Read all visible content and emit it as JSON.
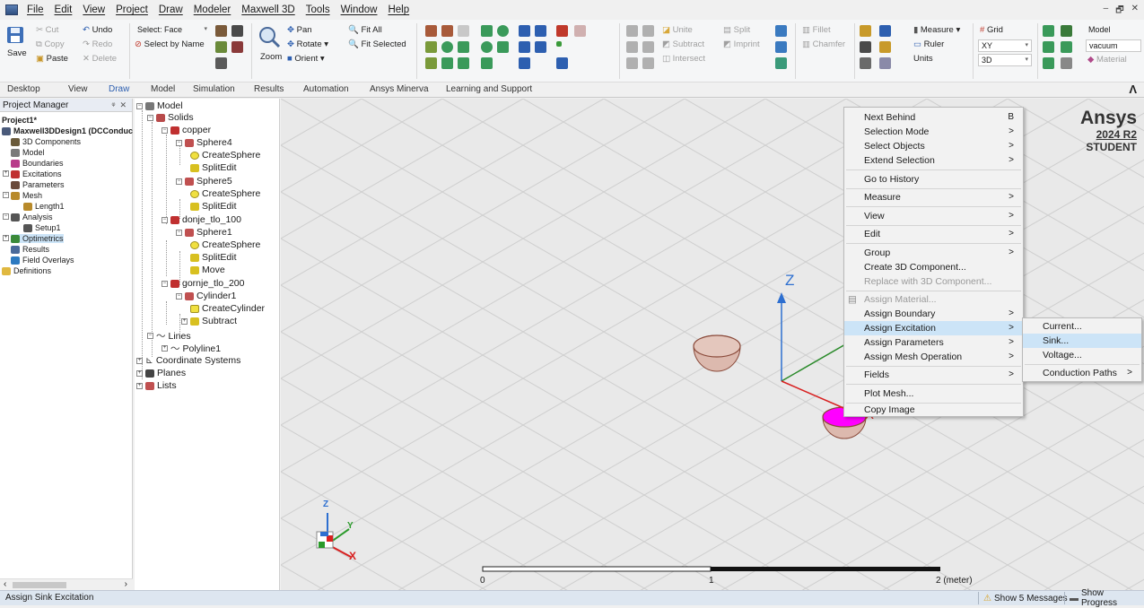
{
  "menubar": {
    "items": [
      "File",
      "Edit",
      "View",
      "Project",
      "Draw",
      "Modeler",
      "Maxwell 3D",
      "Tools",
      "Window",
      "Help"
    ],
    "window_controls": [
      "–",
      "🗗",
      "✕"
    ]
  },
  "ribbon": {
    "save": "Save",
    "cut": "Cut",
    "copy": "Copy",
    "paste": "Paste",
    "undo": "Undo",
    "redo": "Redo",
    "delete": "Delete",
    "select_mode": "Select: Face",
    "select_by_name": "Select by Name",
    "zoom": "Zoom",
    "pan": "Pan",
    "rotate": "Rotate",
    "orient": "Orient",
    "fit_all": "Fit All",
    "fit_selected": "Fit Selected",
    "unite": "Unite",
    "subtract": "Subtract",
    "intersect": "Intersect",
    "split": "Split",
    "imprint": "Imprint",
    "fillet": "Fillet",
    "chamfer": "Chamfer",
    "measure": "Measure",
    "ruler": "Ruler",
    "units": "Units",
    "grid": "Grid",
    "plane": "XY",
    "dimension": "3D",
    "model": "Model",
    "material_value": "vacuum",
    "material": "Material"
  },
  "tabs": [
    "Desktop",
    "View",
    "Draw",
    "Model",
    "Simulation",
    "Results",
    "Automation",
    "Ansys Minerva",
    "Learning and Support"
  ],
  "project_manager": {
    "title": "Project Manager",
    "close": "✕",
    "pin": "ᵠ",
    "items": [
      "Project1*",
      "Maxwell3DDesign1 (DCConduc",
      "3D Components",
      "Model",
      "Boundaries",
      "Excitations",
      "Parameters",
      "Mesh",
      "Length1",
      "Analysis",
      "Setup1",
      "Optimetrics",
      "Results",
      "Field Overlays",
      "Definitions"
    ]
  },
  "model_tree": {
    "items": [
      "Model",
      "Solids",
      "copper",
      "Sphere4",
      "CreateSphere",
      "SplitEdit",
      "Sphere5",
      "CreateSphere",
      "SplitEdit",
      "donje_tlo_100",
      "Sphere1",
      "CreateSphere",
      "SplitEdit",
      "Move",
      "gornje_tlo_200",
      "Cylinder1",
      "CreateCylinder",
      "Subtract",
      "Lines",
      "Polyline1",
      "Coordinate Systems",
      "Planes",
      "Lists"
    ]
  },
  "viewport": {
    "brand": "Ansys",
    "version": "2024 R2",
    "edition": "STUDENT",
    "axis_z": "Z",
    "axis_x": "X",
    "axis_y": "Y",
    "scale_labels": [
      "0",
      "1",
      "2 (meter)"
    ]
  },
  "context_menu": {
    "items": [
      {
        "label": "Next Behind",
        "shortcut": "B"
      },
      {
        "label": "Selection Mode",
        "shortcut": ">"
      },
      {
        "label": "Select Objects",
        "shortcut": ">"
      },
      {
        "label": "Extend Selection",
        "shortcut": ">"
      },
      {
        "label": "Go to History",
        "shortcut": ""
      },
      {
        "label": "Measure",
        "shortcut": ">"
      },
      {
        "label": "View",
        "shortcut": ">"
      },
      {
        "label": "Edit",
        "shortcut": ">"
      },
      {
        "label": "Group",
        "shortcut": ">"
      },
      {
        "label": "Create 3D Component...",
        "shortcut": ""
      },
      {
        "label": "Replace with 3D Component...",
        "shortcut": ""
      },
      {
        "label": "Assign Material...",
        "shortcut": ""
      },
      {
        "label": "Assign Boundary",
        "shortcut": ">"
      },
      {
        "label": "Assign Excitation",
        "shortcut": ">"
      },
      {
        "label": "Assign Parameters",
        "shortcut": ">"
      },
      {
        "label": "Assign Mesh Operation",
        "shortcut": ">"
      },
      {
        "label": "Fields",
        "shortcut": ">"
      },
      {
        "label": "Plot Mesh...",
        "shortcut": ""
      },
      {
        "label": "Copy Image",
        "shortcut": ""
      }
    ]
  },
  "submenu": {
    "items": [
      {
        "label": "Current...",
        "shortcut": ""
      },
      {
        "label": "Sink...",
        "shortcut": ""
      },
      {
        "label": "Voltage...",
        "shortcut": ""
      },
      {
        "label": "Conduction Paths",
        "shortcut": ">"
      }
    ]
  },
  "status": {
    "text": "Assign Sink Excitation",
    "messages": "Show 5 Messages",
    "progress": "Show Progress"
  },
  "colors": {
    "accent": "#2d5fb0",
    "highlight": "#cce4f7",
    "sink_face": "#ff00ff"
  }
}
